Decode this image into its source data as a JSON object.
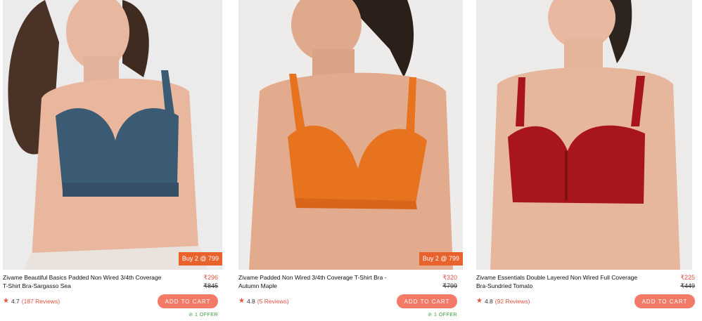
{
  "products": [
    {
      "name": "Zivame Beautiful Basics Padded Non Wired 3/4th Coverage T-Shirt Bra-Sargasso Sea",
      "price": "₹296",
      "mrp": "₹845",
      "rating": "4.7",
      "reviews": "(187 Reviews)",
      "offer_tag": "Buy 2 @ 799",
      "cart_label": "ADD TO CART",
      "offer_count": "1 OFFER",
      "color": "#3b5b74"
    },
    {
      "name": "Zivame Padded Non Wired 3/4th Coverage T-Shirt Bra - Autumn Maple",
      "price": "₹320",
      "mrp": "₹799",
      "rating": "4.8",
      "reviews": "(5 Reviews)",
      "offer_tag": "Buy 2 @ 799",
      "cart_label": "ADD TO CART",
      "offer_count": "1 OFFER",
      "color": "#e8731f"
    },
    {
      "name": "Zivame Essentials Double Layered Non Wired Full Coverage Bra-Sundried Tomato",
      "price": "₹225",
      "mrp": "₹449",
      "rating": "4.8",
      "reviews": "(92 Reviews)",
      "cart_label": "ADD TO CART",
      "color": "#a8161c"
    }
  ],
  "theme": {
    "accent": "#e0543f",
    "button": "#f27a66",
    "offer_tag_bg": "#e8622b",
    "offer_text": "#3a9d3a"
  }
}
